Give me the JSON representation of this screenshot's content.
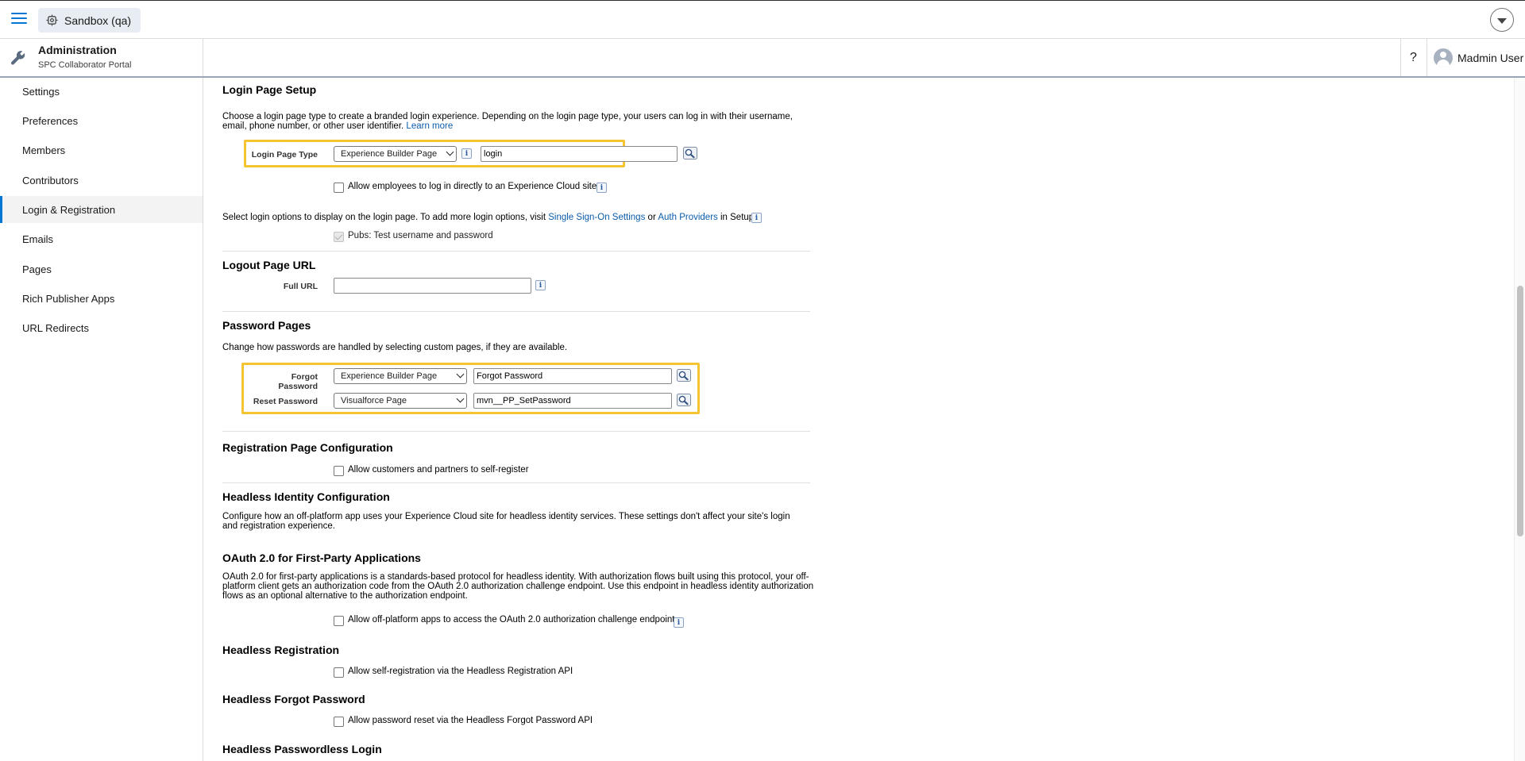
{
  "topbar": {
    "sandbox_label": "Sandbox (qa)"
  },
  "header": {
    "title": "Administration",
    "subtitle": "SPC Collaborator Portal",
    "help_label": "?",
    "user_name": "Madmin User"
  },
  "sidebar": {
    "items": [
      {
        "label": "Settings"
      },
      {
        "label": "Preferences"
      },
      {
        "label": "Members"
      },
      {
        "label": "Contributors"
      },
      {
        "label": "Login & Registration",
        "active": true
      },
      {
        "label": "Emails"
      },
      {
        "label": "Pages"
      },
      {
        "label": "Rich Publisher Apps"
      },
      {
        "label": "URL Redirects"
      }
    ]
  },
  "login_setup": {
    "title": "Login Page Setup",
    "desc_part1": "Choose a login page type to create a branded login experience. Depending on the login page type, your users can log in with their username, email, phone number, or other user identifier.",
    "learn_more": "Learn more",
    "type_label": "Login Page Type",
    "type_value": "Experience Builder Page",
    "page_value": "login",
    "employees_label": "Allow employees to log in directly to an Experience Cloud site",
    "options_text_1": "Select login options to display on the login page. To add more login options, visit",
    "sso_link": "Single Sign-On Settings",
    "options_or": "or",
    "auth_link": "Auth Providers",
    "options_text_2": "in Setup.",
    "pubs_label": "Pubs: Test username and password"
  },
  "logout": {
    "title": "Logout Page URL",
    "full_url_label": "Full URL",
    "full_url_value": ""
  },
  "password_pages": {
    "title": "Password Pages",
    "desc": "Change how passwords are handled by selecting custom pages, if they are available.",
    "forgot_label": "Forgot Password",
    "forgot_type": "Experience Builder Page",
    "forgot_value": "Forgot Password",
    "reset_label": "Reset Password",
    "reset_type": "Visualforce Page",
    "reset_value": "mvn__PP_SetPassword"
  },
  "registration": {
    "title": "Registration Page Configuration",
    "self_register_label": "Allow customers and partners to self-register"
  },
  "headless": {
    "title": "Headless Identity Configuration",
    "desc": "Configure how an off-platform app uses your Experience Cloud site for headless identity services. These settings don't affect your site's login and registration experience."
  },
  "oauth": {
    "title": "OAuth 2.0 for First-Party Applications",
    "desc": "OAuth 2.0 for first-party applications is a standards-based protocol for headless identity. With authorization flows built using this protocol, your off-platform client gets an authorization code from the OAuth 2.0 authorization challenge endpoint. Use this endpoint in headless identity authorization flows as an optional alternative to the authorization endpoint.",
    "allow_label": "Allow off-platform apps to access the OAuth 2.0 authorization challenge endpoint"
  },
  "headless_registration": {
    "title": "Headless Registration",
    "allow_label": "Allow self-registration via the Headless Registration API"
  },
  "headless_forgot": {
    "title": "Headless Forgot Password",
    "allow_label": "Allow password reset via the Headless Forgot Password API"
  },
  "headless_passwordless": {
    "title": "Headless Passwordless Login"
  },
  "info_glyph": "i",
  "colors": {
    "accent": "#0176d3",
    "highlight": "#f5c431",
    "link": "#0b5cab"
  }
}
